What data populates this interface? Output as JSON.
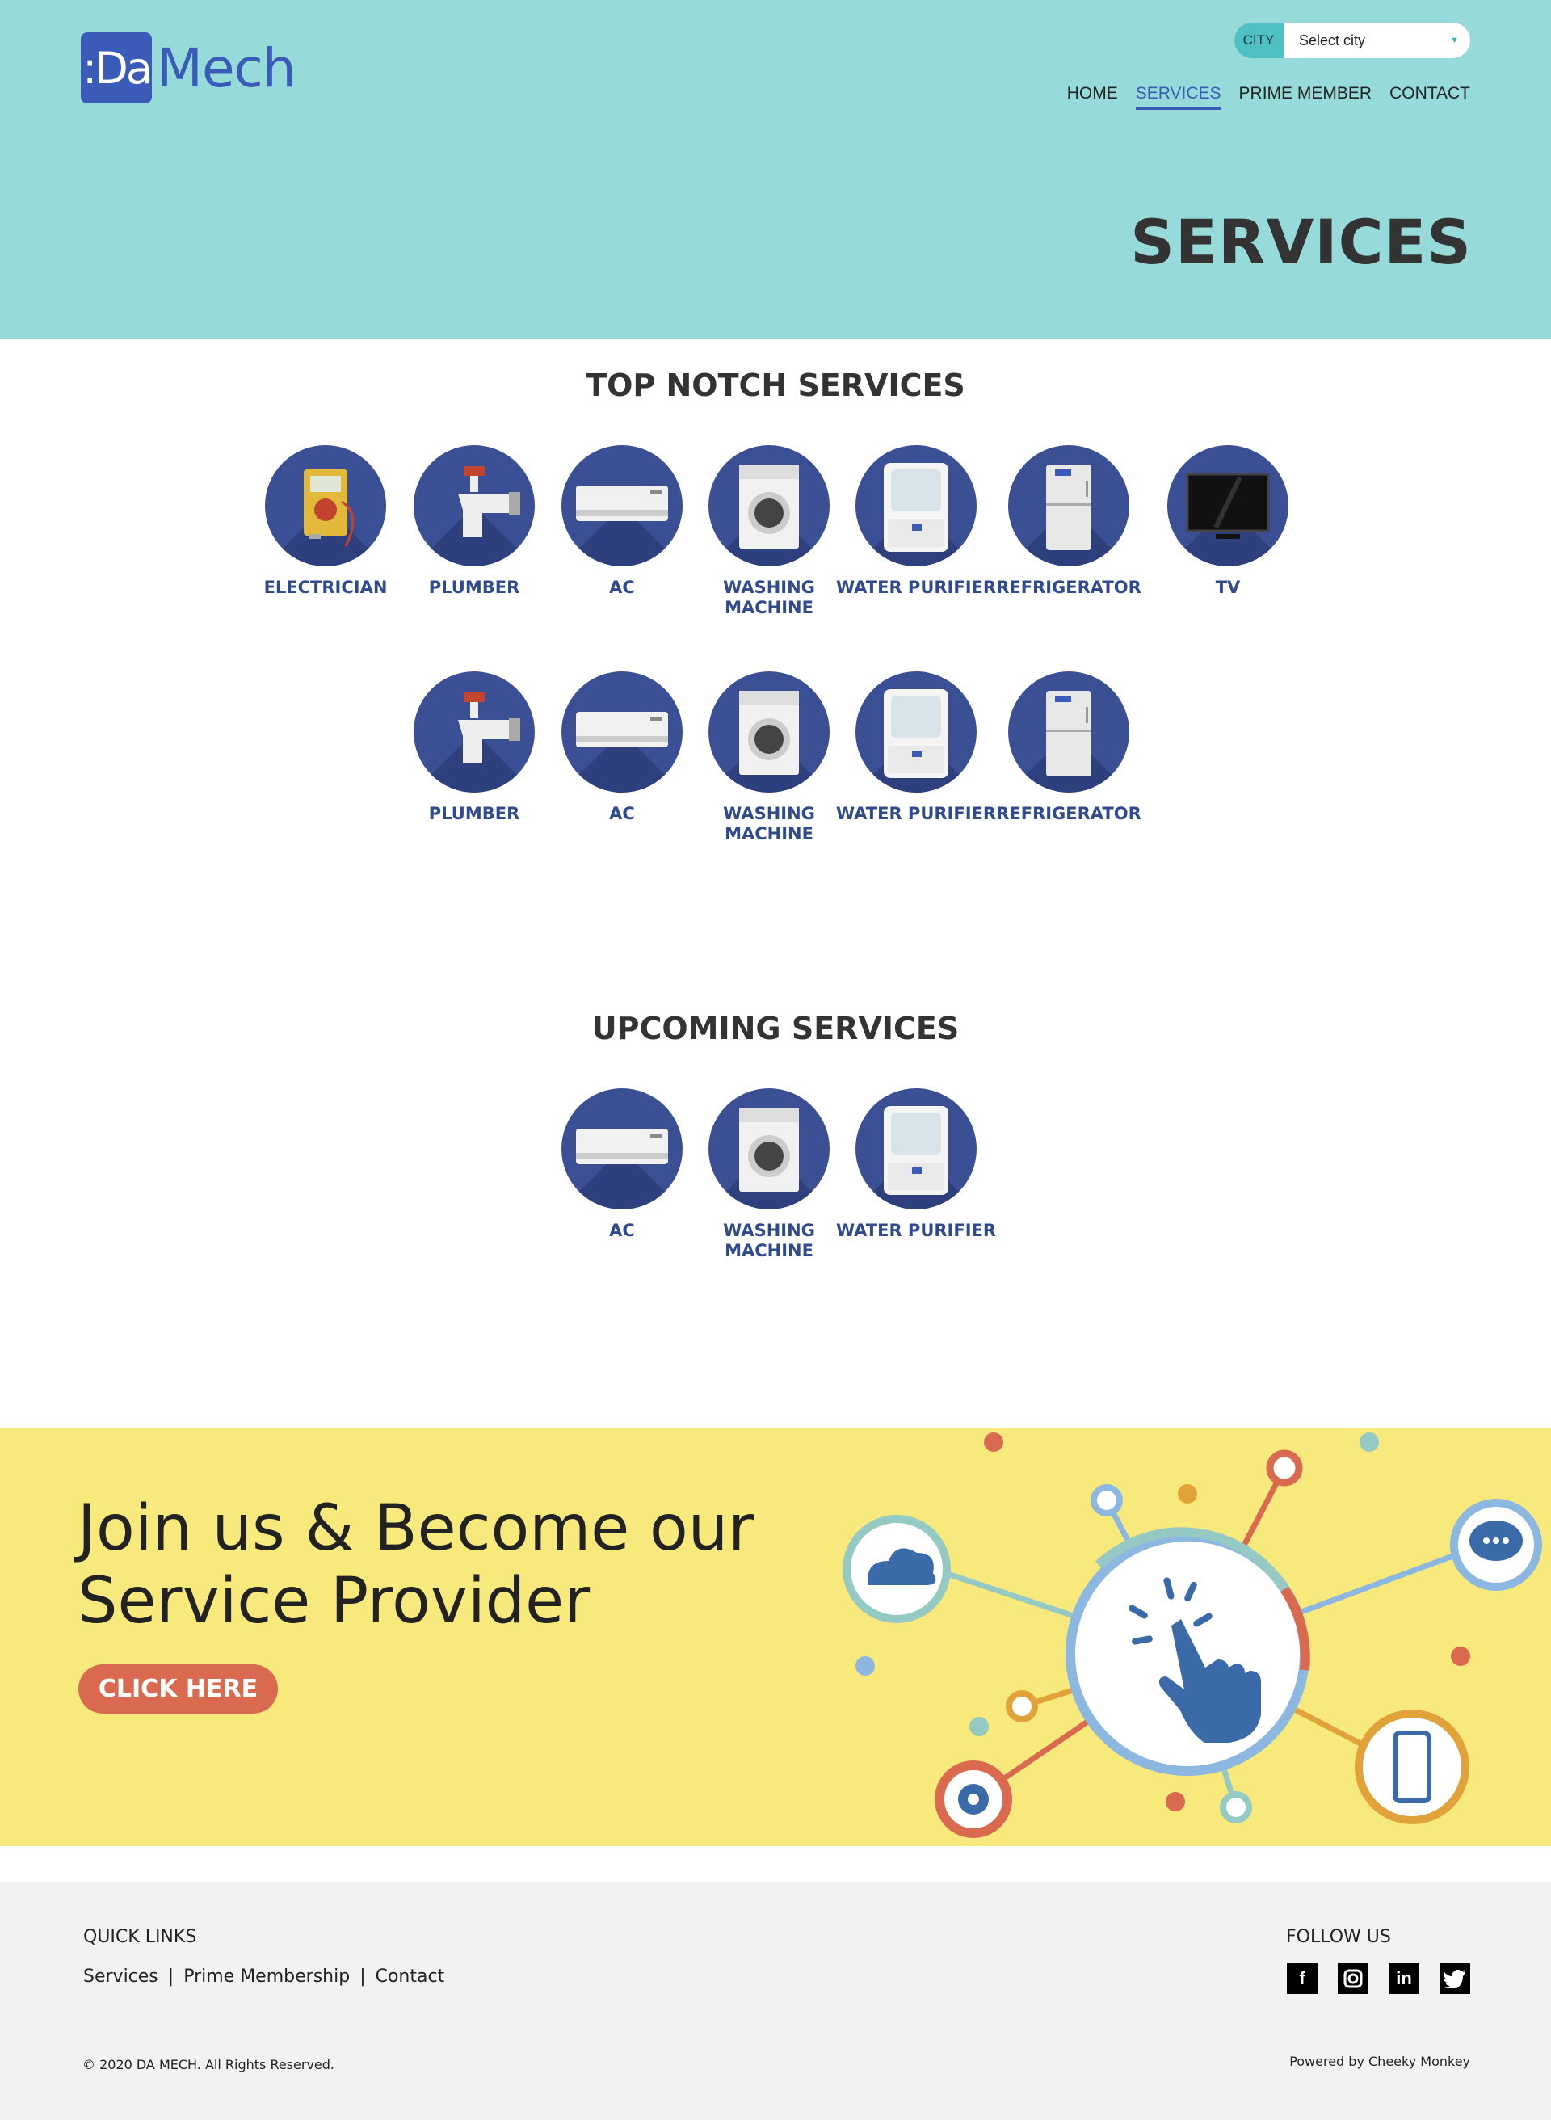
{
  "header": {
    "logo_mark": ":Da",
    "logo_text": "Mech",
    "city_label": "CITY",
    "city_select_value": "Select city",
    "nav": [
      "HOME",
      "SERVICES",
      "PRIME MEMBER",
      "CONTACT"
    ],
    "active_nav": "SERVICES"
  },
  "hero": {
    "title": "SERVICES"
  },
  "top_services": {
    "title": "TOP NOTCH SERVICES",
    "row1": [
      {
        "label": "ELECTRICIAN",
        "icon": "multimeter-icon"
      },
      {
        "label": "PLUMBER",
        "icon": "tap-icon"
      },
      {
        "label": "AC",
        "icon": "ac-icon"
      },
      {
        "label": "WASHING MACHINE",
        "icon": "washing-machine-icon"
      },
      {
        "label": "WATER PURIFIER",
        "icon": "water-purifier-icon"
      },
      {
        "label": "REFRIGERATOR",
        "icon": "refrigerator-icon"
      },
      {
        "label": "TV",
        "icon": "tv-icon"
      }
    ],
    "row2": [
      {
        "label": "PLUMBER",
        "icon": "tap-icon"
      },
      {
        "label": "AC",
        "icon": "ac-icon"
      },
      {
        "label": "WASHING MACHINE",
        "icon": "washing-machine-icon"
      },
      {
        "label": "WATER PURIFIER",
        "icon": "water-purifier-icon"
      },
      {
        "label": "REFRIGERATOR",
        "icon": "refrigerator-icon"
      }
    ]
  },
  "upcoming_services": {
    "title": "UPCOMING SERVICES",
    "items": [
      {
        "label": "AC",
        "icon": "ac-icon"
      },
      {
        "label": "WASHING MACHINE",
        "icon": "washing-machine-icon"
      },
      {
        "label": "WATER PURIFIER",
        "icon": "water-purifier-icon"
      }
    ]
  },
  "join": {
    "line1": "Join us & Become our",
    "line2": "Service Provider",
    "button": "CLICK HERE"
  },
  "footer": {
    "quick_links_title": "QUICK LINKS",
    "links": [
      "Services",
      "Prime Membership",
      "Contact"
    ],
    "separator": "|",
    "follow_title": "FOLLOW US",
    "social": [
      "facebook-icon",
      "instagram-icon",
      "linkedin-icon",
      "twitter-icon"
    ],
    "copyright": "© 2020 DA MECH. All Rights Reserved.",
    "powered": "Powered by Cheeky Monkey"
  },
  "colors": {
    "hero_bg": "#96dad9",
    "brand_blue": "#3a5cb8",
    "circle_blue": "#3b4f95",
    "banner_yellow": "#f7e97c",
    "button_orange": "#d96a4f",
    "footer_bg": "#f2f2f2"
  }
}
